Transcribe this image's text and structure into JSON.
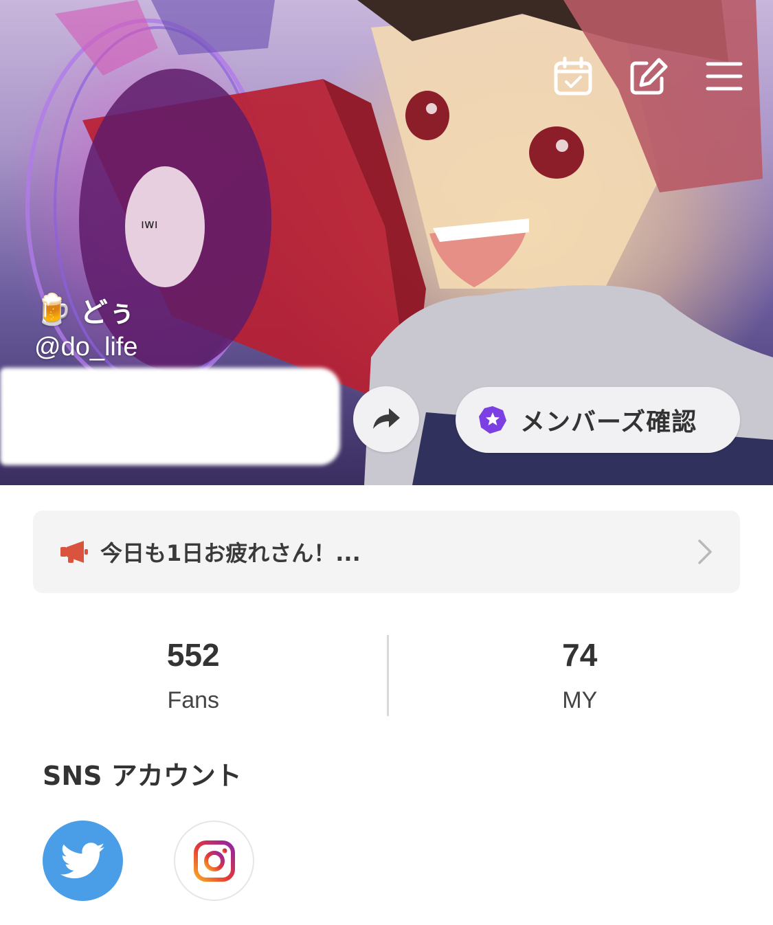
{
  "header": {
    "icons": [
      "calendar-check-icon",
      "edit-icon",
      "menu-icon"
    ]
  },
  "profile": {
    "emoji": "🍺",
    "display_name": "どぅ",
    "handle": "@do_life"
  },
  "actions": {
    "share_icon": "share-arrow-icon",
    "members_label": "メンバーズ確認",
    "members_icon": "star-badge-icon"
  },
  "announcement": {
    "icon": "megaphone-icon",
    "text": "今日も1日お疲れさん！..."
  },
  "stats": {
    "fans_value": "552",
    "fans_label": "Fans",
    "my_value": "74",
    "my_label": "MY"
  },
  "sns": {
    "title": "SNS アカウント",
    "accounts": [
      "twitter-icon",
      "instagram-icon"
    ]
  },
  "colors": {
    "accent_purple": "#7b3fe4",
    "twitter_blue": "#4a9ee8",
    "megaphone_red": "#d9533e"
  }
}
